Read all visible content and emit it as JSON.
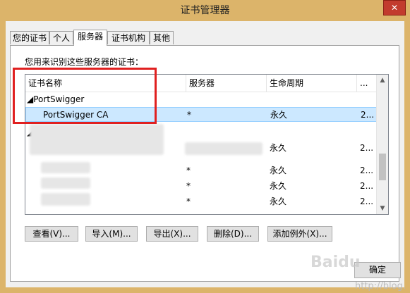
{
  "window": {
    "title": "证书管理器",
    "close_glyph": "✕"
  },
  "tabs": [
    {
      "label": "您的证书",
      "active": false
    },
    {
      "label": "个人",
      "active": false
    },
    {
      "label": "服务器",
      "active": true
    },
    {
      "label": "证书机构",
      "active": false
    },
    {
      "label": "其他",
      "active": false
    }
  ],
  "panel": {
    "description": "您用来识别这些服务器的证书：",
    "columns": [
      "证书名称",
      "服务器",
      "生命周期",
      "..."
    ],
    "column_picker_icon": "column-picker-icon",
    "groups": [
      {
        "name": "PortSwigger",
        "rows": [
          {
            "name": "PortSwigger CA",
            "server": "*",
            "lifetime": "永久",
            "extra": "2...",
            "selected": true
          }
        ]
      },
      {
        "name": "",
        "rows": [
          {
            "name": "",
            "server": "",
            "lifetime": "永久",
            "extra": "2...",
            "selected": false
          },
          {
            "name": "",
            "server": "*",
            "lifetime": "永久",
            "extra": "2...",
            "selected": false
          },
          {
            "name": "",
            "server": "*",
            "lifetime": "永久",
            "extra": "2...",
            "selected": false
          },
          {
            "name": "",
            "server": "*",
            "lifetime": "永久",
            "extra": "2...",
            "selected": false
          }
        ]
      }
    ]
  },
  "buttons": {
    "view": "查看(V)...",
    "import": "导入(M)...",
    "export": "导出(X)...",
    "delete": "删除(D)...",
    "add_exception": "添加例外(X)..."
  },
  "ok_label": "确定",
  "colors": {
    "title_bar": "#dcb46a",
    "selection": "#cce8ff",
    "annotation": "#e02020"
  },
  "watermark": {
    "text": "http://blog.",
    "logo": "Baidu"
  }
}
